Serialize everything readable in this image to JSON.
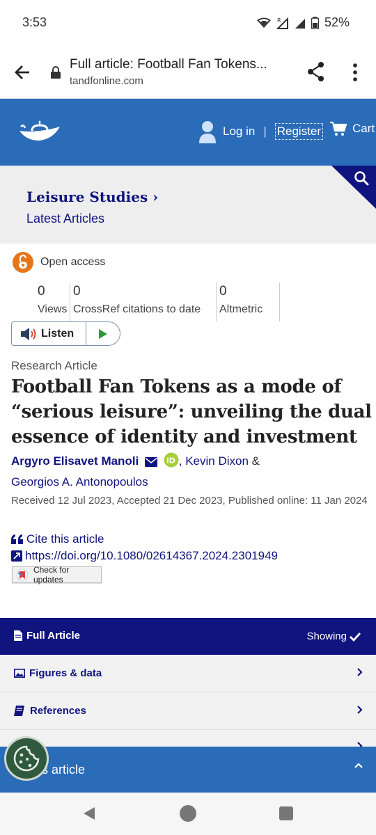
{
  "status_bar": {
    "time": "3:53",
    "battery": "52%"
  },
  "browser": {
    "page_title": "Full article: Football Fan Tokens...",
    "domain": "tandfonline.com"
  },
  "header": {
    "login": "Log in",
    "separator": "|",
    "register": "Register",
    "cart": "Cart",
    "brand_color": "#2b6cb8"
  },
  "journal": {
    "title": "Leisure Studies",
    "chevron": "›",
    "subtitle": "Latest Articles"
  },
  "access": {
    "label": "Open access",
    "icon": "open-lock-icon",
    "color": "#e8751a"
  },
  "metrics": [
    {
      "value": "0",
      "label": "Views"
    },
    {
      "value": "0",
      "label": "CrossRef citations to date"
    },
    {
      "value": "0",
      "label": "Altmetric"
    }
  ],
  "listen": {
    "label": "Listen"
  },
  "article": {
    "type": "Research Article",
    "title": "Football Fan Tokens as a mode of “serious leisure”: unveiling the dual essence of identity and investment",
    "authors": {
      "first": "Argyro Elisavet Manoli",
      "comma": ",",
      "second": "Kevin Dixon",
      "amp": "&",
      "third": "Georgios A. Antonopoulos"
    },
    "dates": "Received 12 Jul 2023, Accepted 21 Dec 2023, Published online: 11 Jan 2024",
    "cite": "Cite this article",
    "doi": "https://doi.org/10.1080/02614367.2024.2301949",
    "check_updates": "Check for updates"
  },
  "tabs": {
    "full_article": "Full Article",
    "showing": "Showing",
    "figures": "Figures & data",
    "references": "References",
    "bottom": "is article"
  },
  "colors": {
    "navy": "#10147e",
    "link": "#10147e"
  }
}
